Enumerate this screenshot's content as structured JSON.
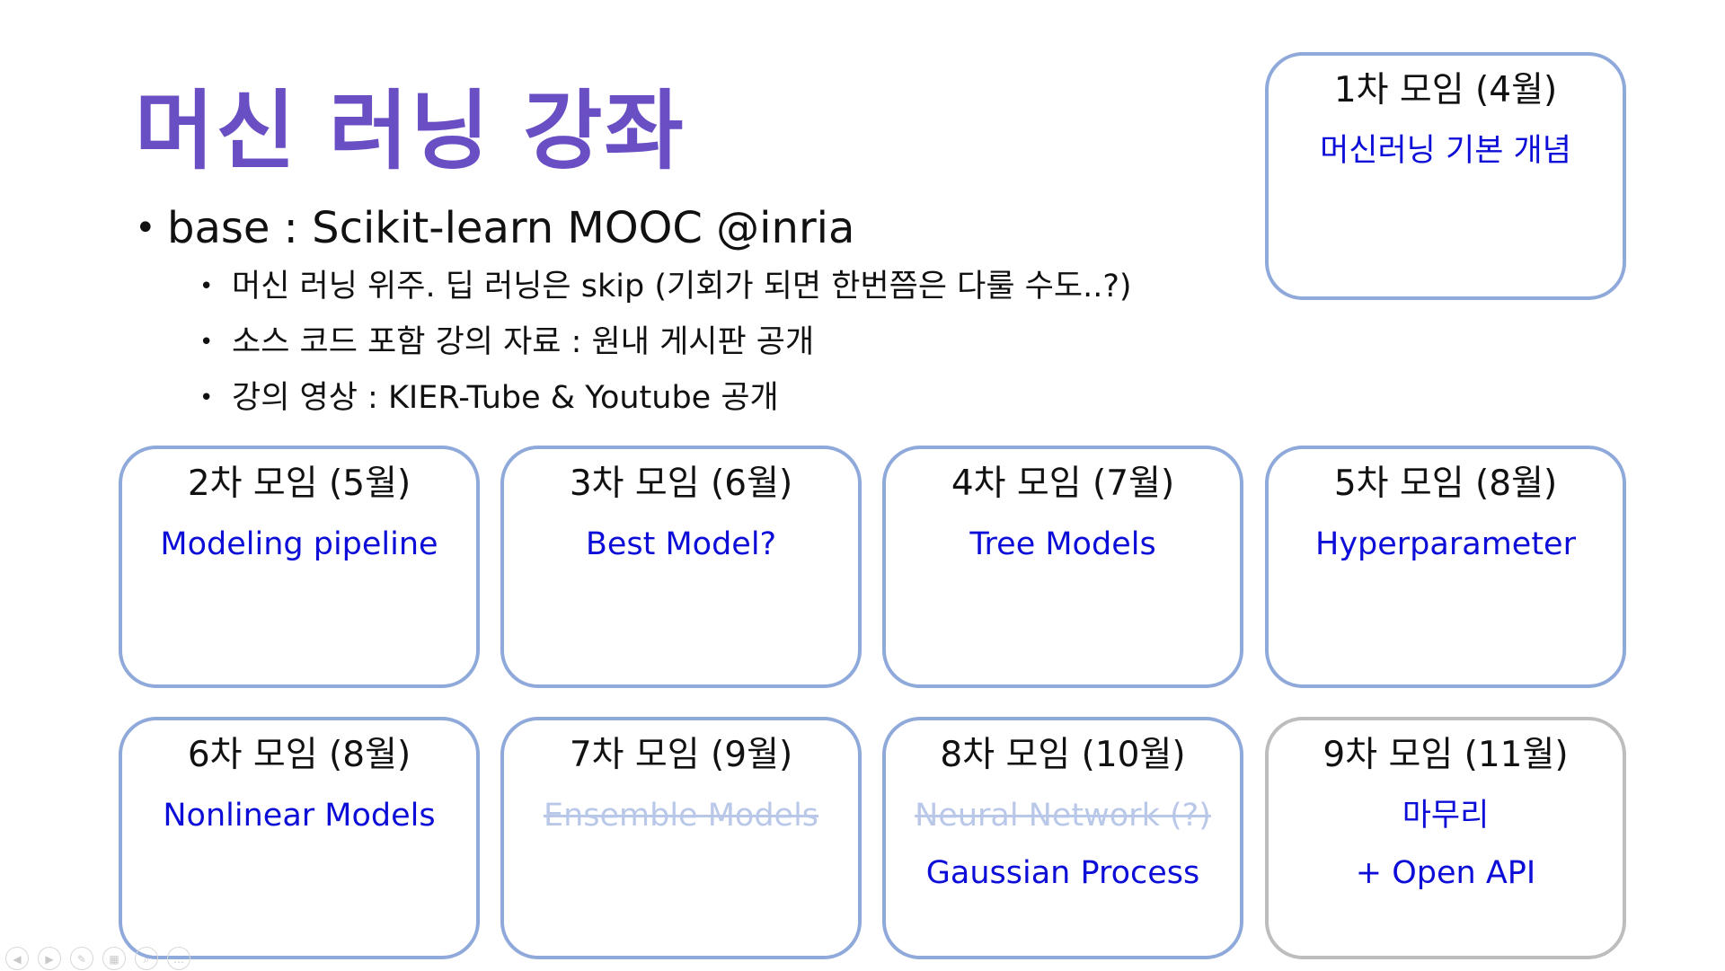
{
  "slide": {
    "title": "머신 러닝 강좌",
    "bullet_main": "base : Scikit-learn MOOC @inria",
    "sub_bullets": [
      "머신 러닝 위주. 딥 러닝은 skip (기회가 되면 한번쯤은 다룰 수도..?)",
      "소스 코드 포함 강의 자료 : 원내 게시판 공개",
      "강의 영상 : KIER-Tube & Youtube 공개"
    ]
  },
  "sessions": [
    {
      "header": "1차 모임 (4월)",
      "topics": [
        "머신러닝 기본 개념"
      ]
    },
    {
      "header": "2차 모임 (5월)",
      "topics": [
        "Modeling pipeline"
      ]
    },
    {
      "header": "3차 모임 (6월)",
      "topics": [
        "Best Model?"
      ]
    },
    {
      "header": "4차 모임 (7월)",
      "topics": [
        "Tree Models"
      ]
    },
    {
      "header": "5차 모임 (8월)",
      "topics": [
        "Hyperparameter"
      ]
    },
    {
      "header": "6차 모임 (8월)",
      "topics": [
        "Nonlinear Models"
      ]
    },
    {
      "header": "7차 모임 (9월)",
      "topics": [
        "Ensemble Models"
      ],
      "strikethrough": [
        true
      ]
    },
    {
      "header": "8차 모임 (10월)",
      "topics": [
        "Neural Network (?)",
        "Gaussian Process"
      ],
      "strikethrough": [
        true,
        false
      ]
    },
    {
      "header": "9차 모임 (11월)",
      "topics": [
        "마무리",
        "+ Open API"
      ],
      "status": "gray-border"
    }
  ],
  "colors": {
    "title": "#6a4fc4",
    "topic_text": "#0d0dd8",
    "box_border": "#8fa9da",
    "box_border_final": "#bdbdbd",
    "strikethrough_text": "#b9c8e8"
  },
  "presenter_controls": [
    {
      "icon": "previous-icon"
    },
    {
      "icon": "next-icon"
    },
    {
      "icon": "pen-icon"
    },
    {
      "icon": "slides-icon"
    },
    {
      "icon": "zoom-icon"
    },
    {
      "icon": "more-icon"
    }
  ]
}
